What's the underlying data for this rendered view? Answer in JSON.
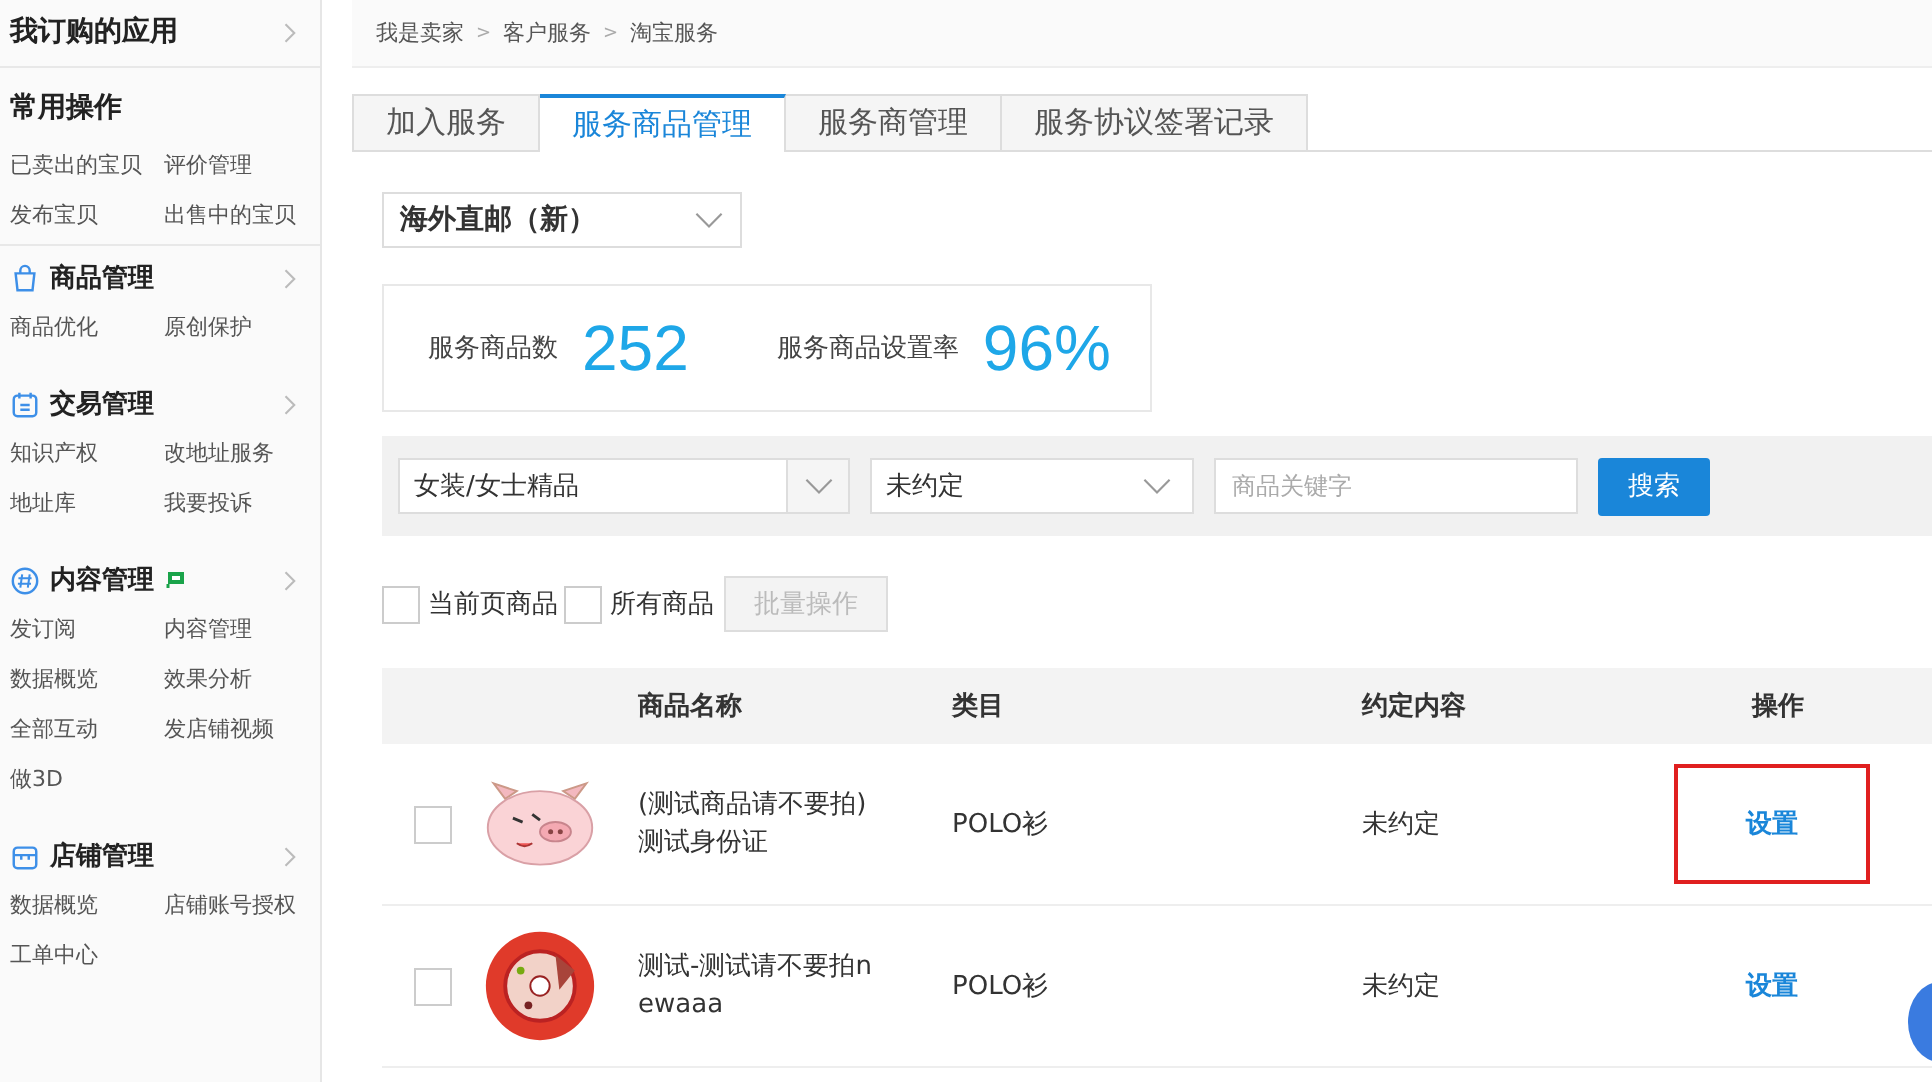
{
  "sidebar": {
    "sections": [
      {
        "title": "我订购的应用",
        "kind": "top",
        "badge": false,
        "arrow": true
      },
      {
        "title": "常用操作",
        "kind": "top",
        "badge": false,
        "arrow": false,
        "items": [
          "已卖出的宝贝",
          "评价管理",
          "发布宝贝",
          "出售中的宝贝"
        ]
      },
      {
        "title": "商品管理",
        "kind": "bag",
        "badge": false,
        "arrow": true,
        "items": [
          "商品优化",
          "原创保护"
        ]
      },
      {
        "title": "交易管理",
        "kind": "note",
        "badge": false,
        "arrow": true,
        "items": [
          "知识产权",
          "改地址服务",
          "地址库",
          "我要投诉"
        ]
      },
      {
        "title": "内容管理",
        "kind": "hash",
        "badge": true,
        "arrow": true,
        "items": [
          "发订阅",
          "内容管理",
          "数据概览",
          "效果分析",
          "全部互动",
          "发店铺视频",
          "做3D"
        ]
      },
      {
        "title": "店铺管理",
        "kind": "store",
        "badge": false,
        "arrow": true,
        "items": [
          "数据概览",
          "店铺账号授权",
          "工单中心"
        ]
      }
    ]
  },
  "breadcrumb": {
    "items": [
      "我是卖家",
      "客户服务",
      "淘宝服务"
    ],
    "separator": ">"
  },
  "tabs": [
    {
      "label": "加入服务",
      "selected": false
    },
    {
      "label": "服务商品管理",
      "selected": true
    },
    {
      "label": "服务商管理",
      "selected": false
    },
    {
      "label": "服务协议签署记录",
      "selected": false
    }
  ],
  "service_select": {
    "value": "海外直邮（新）"
  },
  "stats": [
    {
      "label": "服务商品数",
      "value": "252"
    },
    {
      "label": "服务商品设置率",
      "value": "96%"
    }
  ],
  "filters": {
    "category": "女装/女士精品",
    "agreement": "未约定",
    "keyword_placeholder": "商品关键字",
    "search_button": "搜索"
  },
  "bulk": {
    "options": [
      {
        "label": "当前页商品",
        "checked": false
      },
      {
        "label": "所有商品",
        "checked": false
      }
    ],
    "button": "批量操作",
    "button_disabled": true
  },
  "table": {
    "columns": [
      "商品名称",
      "类目",
      "约定内容",
      "操作"
    ],
    "rows": [
      {
        "checked": false,
        "kind": "pig",
        "name": "(测试商品请不要拍)\n测试身份证",
        "category": "POLO衫",
        "agreement": "未约定",
        "action": "设置",
        "highlighted": true
      },
      {
        "checked": false,
        "kind": "disc",
        "name": "测试-测试请不要拍n\newaaa",
        "category": "POLO衫",
        "agreement": "未约定",
        "action": "设置",
        "highlighted": false
      }
    ]
  }
}
